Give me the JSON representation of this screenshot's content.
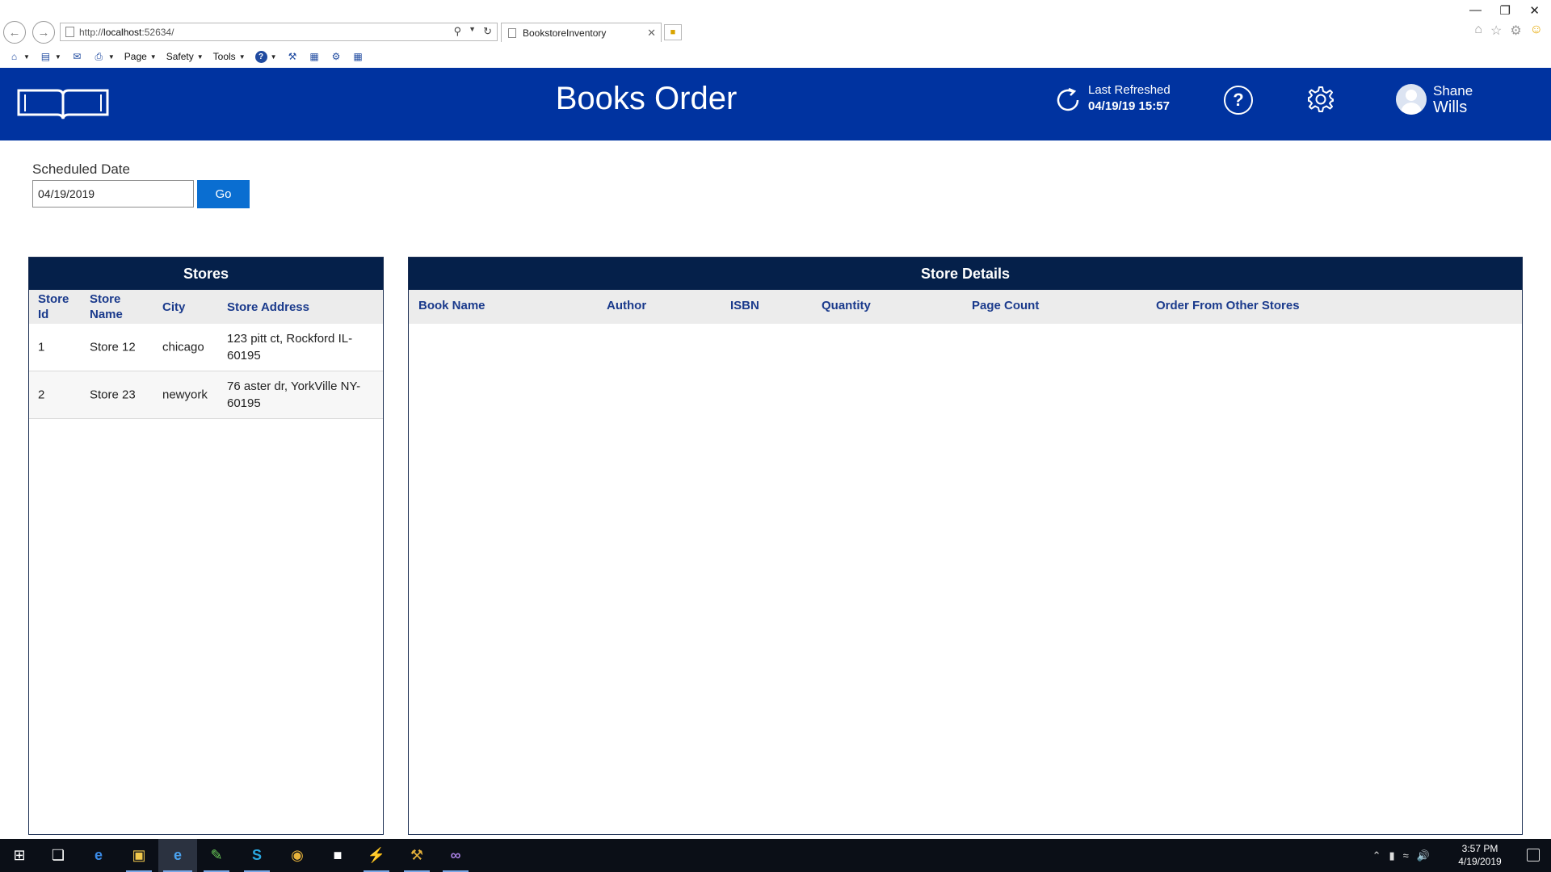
{
  "browser": {
    "url_prefix": "http://",
    "url_host": "localhost",
    "url_rest": ":52634/",
    "tab_title": "BookstoreInventory",
    "tab_close": "✕",
    "win_min": "—",
    "win_restore": "❐",
    "win_close": "✕",
    "menu": {
      "page": "Page",
      "safety": "Safety",
      "tools": "Tools"
    }
  },
  "header": {
    "title": "Books Order",
    "last_refreshed_label": "Last Refreshed",
    "last_refreshed_value": "04/19/19 15:57",
    "help_symbol": "?",
    "user_first": "Shane",
    "user_last": "Wills"
  },
  "filter": {
    "label": "Scheduled Date",
    "date_value": "04/19/2019",
    "go_label": "Go"
  },
  "stores": {
    "title": "Stores",
    "columns": [
      "Store Id",
      "Store Name",
      "City",
      "Store Address"
    ],
    "rows": [
      {
        "id": "1",
        "name": "Store 12",
        "city": "chicago",
        "address": "123 pitt ct, Rockford IL-60195"
      },
      {
        "id": "2",
        "name": "Store 23",
        "city": "newyork",
        "address": "76 aster dr, YorkVille NY-60195"
      }
    ]
  },
  "details": {
    "title": "Store Details",
    "columns": [
      "Book Name",
      "Author",
      "ISBN",
      "Quantity",
      "Page Count",
      "Order From Other Stores"
    ]
  },
  "taskbar": {
    "time": "3:57 PM",
    "date": "4/19/2019"
  },
  "colors": {
    "header_bg": "#0033a0",
    "panel_head_bg": "#05204a",
    "go_button": "#0a6ed1",
    "column_header_text": "#1a3a8c"
  }
}
